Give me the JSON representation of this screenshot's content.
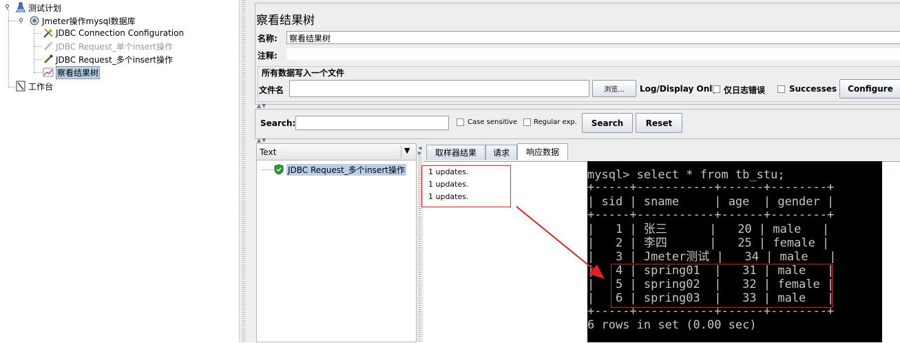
{
  "tree": {
    "test_plan": "测试计划",
    "thread_group": "Jmeter操作mysql数据库",
    "jdbc_config": "JDBC Connection Configuration",
    "request_single": "JDBC Request_单个insert操作",
    "request_multi": "JDBC Request_多个insert操作",
    "result_tree": "察看结果树",
    "workbench": "工作台"
  },
  "panel": {
    "title": "察看结果树",
    "name_label": "名称:",
    "name_value": "察看结果树",
    "comment_label": "注释:",
    "comment_value": "",
    "file_group_title": "所有数据写入一个文件",
    "filename_label": "文件名",
    "filename_value": "",
    "browse_button": "浏览...",
    "log_display_label": "Log/Display Only:",
    "errors_only_label": "仅日志错误",
    "successes_label": "Successes",
    "configure_button": "Configure"
  },
  "search": {
    "label": "Search:",
    "value": "",
    "case_sensitive": "Case sensitive",
    "regular_exp": "Regular exp.",
    "search_button": "Search",
    "reset_button": "Reset"
  },
  "results": {
    "renderer": "Text",
    "sample_item": "JDBC Request_多个insert操作",
    "tabs": [
      "取样器结果",
      "请求",
      "响应数据"
    ],
    "active_tab": "响应数据",
    "response_lines": [
      "1 updates.",
      "1 updates.",
      "1 updates."
    ]
  },
  "terminal": {
    "command": "mysql> select * from tb_stu;",
    "border": "+-----+-----------+------+--------+",
    "header": "| sid | sname     | age  | gender |",
    "rows": [
      "|   1 | 张三      |   20 | male   |",
      "|   2 | 李四      |   25 | female |",
      "|   3 | Jmeter测试 |   34 | male   |",
      "|   4 | spring01  |   31 | male   |",
      "|   5 | spring02  |   32 | female |",
      "|   6 | spring03  |   33 | male   |"
    ],
    "footer": "6 rows in set (0.00 sec)"
  },
  "colors": {
    "highlight_box": "#e02020",
    "selection": "#b8cfe5",
    "panel_bg": "#eeeeee",
    "terminal_bg": "#000000",
    "terminal_fg": "#c6c6c6"
  }
}
